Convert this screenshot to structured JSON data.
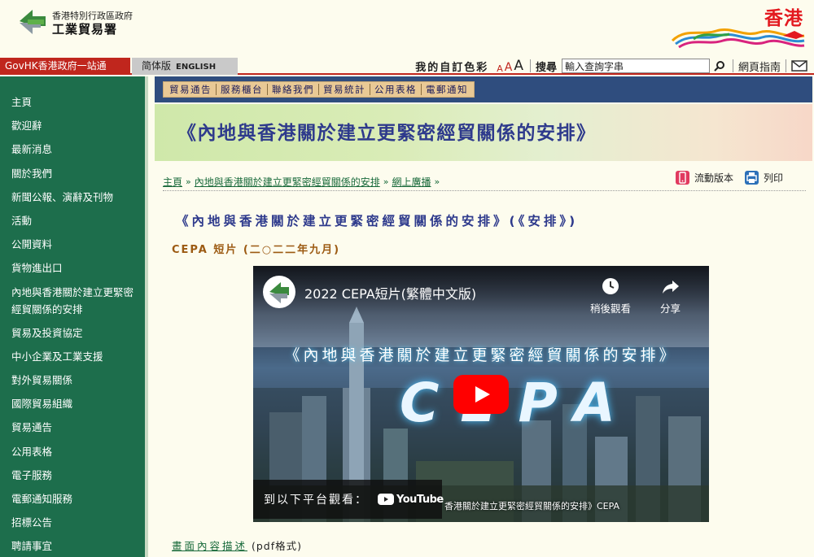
{
  "header": {
    "dept_top": "香港特別行政區政府",
    "dept_name": "工業貿易署",
    "brand_text": "香港"
  },
  "topbar": {
    "govhk": "GovHK香港政府一站通",
    "lang_simplified": "简体版",
    "lang_english": "ENGLISH",
    "colour_label": "我的自訂色彩",
    "font_small": "A",
    "font_medium": "A",
    "font_large": "A",
    "search_label": "搜尋",
    "search_placeholder": "輸入查詢字串",
    "sitemap": "網頁指南"
  },
  "leftnav": {
    "items": [
      "主頁",
      "歡迎辭",
      "最新消息",
      "關於我們",
      "新聞公報、演辭及刊物",
      "活動",
      "公開資料",
      "貨物進出口",
      "內地與香港關於建立更緊密經貿關係的安排",
      "貿易及投資協定",
      "中小企業及工業支援",
      "對外貿易關係",
      "國際貿易組織",
      "貿易通告",
      "公用表格",
      "電子服務",
      "電郵通知服務",
      "招標公告",
      "聘請事宜"
    ]
  },
  "subnav": {
    "items": [
      "貿易通告",
      "服務櫃台",
      "聯絡我們",
      "貿易統計",
      "公用表格",
      "電郵通知"
    ]
  },
  "banner": {
    "title": "《內地與香港關於建立更緊密經貿關係的安排》"
  },
  "breadcrumb": {
    "items": [
      "主頁",
      "內地與香港關於建立更緊密經貿關係的安排",
      "網上廣播"
    ]
  },
  "page_tools": {
    "mobile": "流動版本",
    "print": "列印"
  },
  "article": {
    "title": "《內地與香港關於建立更緊密經貿關係的安排》(《安排》)",
    "caption": "CEPA 短片 (二○二二年九月)"
  },
  "video": {
    "title": "2022 CEPA短片(繁體中文版)",
    "watch_later": "稍後觀看",
    "share": "分享",
    "headline": "《內地與香港關於建立更緊密經貿關係的安排》",
    "logo_text": "CEPA",
    "watch_on": "到以下平台觀看：",
    "youtube": "YouTube",
    "subtitle": "香港關於建立更緊密經貿關係的安排》CEPA"
  },
  "description": {
    "link": "畫面內容描述",
    "suffix": "(pdf格式)"
  },
  "colors": {
    "nav_green": "#1d6e4c",
    "govhk_red": "#c0261d",
    "subnav_blue": "#2f4d7e",
    "title_blue": "#2e3a8c",
    "caption_brown": "#9c5a12"
  }
}
